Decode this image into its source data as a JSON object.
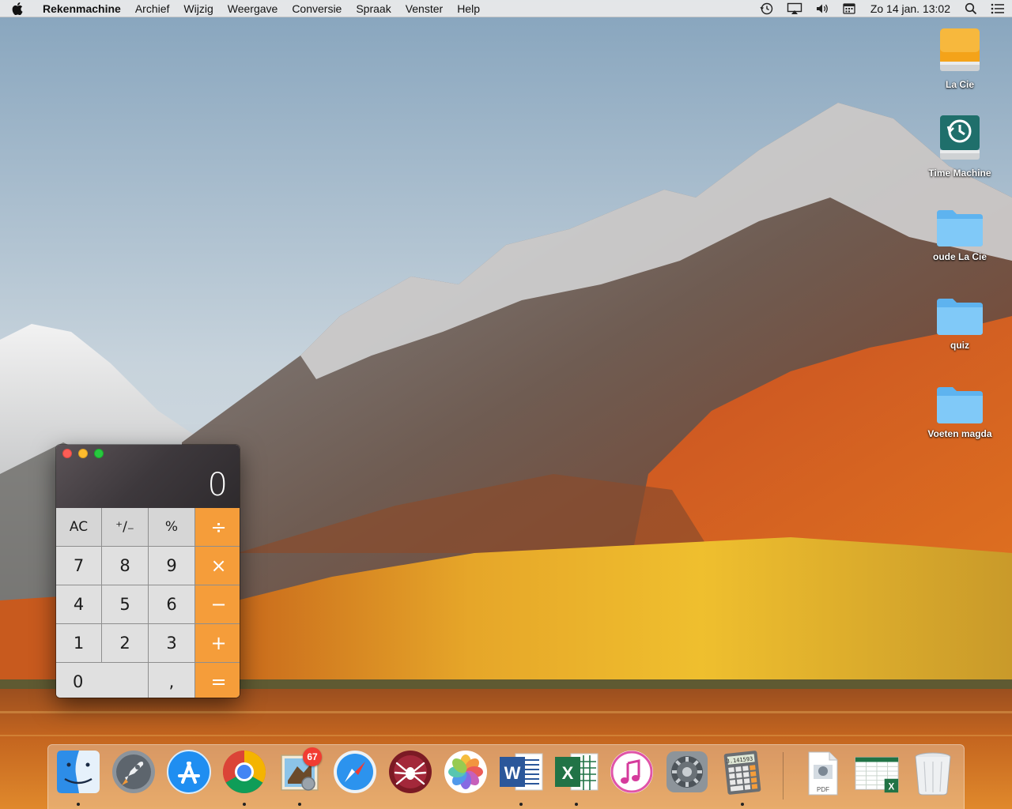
{
  "menubar": {
    "app_name": "Rekenmachine",
    "items": [
      "Archief",
      "Wijzig",
      "Weergave",
      "Conversie",
      "Spraak",
      "Venster",
      "Help"
    ],
    "clock": "Zo 14 jan.  13:02",
    "status_icons": [
      "time-machine-icon",
      "airplay-icon",
      "volume-icon",
      "calendar-icon"
    ]
  },
  "desktop": {
    "icons": [
      {
        "label": "La Cie",
        "icon": "external-drive-icon"
      },
      {
        "label": "Time Machine",
        "icon": "time-machine-drive-icon"
      },
      {
        "label": "oude La Cie",
        "icon": "folder-icon"
      },
      {
        "label": "quiz",
        "icon": "folder-icon"
      },
      {
        "label": "Voeten magda",
        "icon": "folder-icon"
      }
    ]
  },
  "calculator": {
    "display": "0",
    "keys": {
      "ac": "AC",
      "sign": "⁺∕₋",
      "percent": "%",
      "divide": "÷",
      "seven": "7",
      "eight": "8",
      "nine": "9",
      "multiply": "×",
      "four": "4",
      "five": "5",
      "six": "6",
      "minus": "−",
      "one": "1",
      "two": "2",
      "three": "3",
      "plus": "+",
      "zero": "0",
      "decimal": ",",
      "equals": "="
    },
    "colors": {
      "operator": "#f59d3a",
      "digit": "#e0e0e0",
      "function": "#d6d6d6"
    }
  },
  "dock": {
    "items": [
      {
        "icon": "finder-icon",
        "running": true
      },
      {
        "icon": "launchpad-icon",
        "running": false
      },
      {
        "icon": "app-store-icon",
        "running": false
      },
      {
        "icon": "chrome-icon",
        "running": true
      },
      {
        "icon": "mail-icon",
        "running": true,
        "badge": "67"
      },
      {
        "icon": "safari-icon",
        "running": false
      },
      {
        "icon": "spider-app-icon",
        "running": false
      },
      {
        "icon": "photos-icon",
        "running": false
      },
      {
        "icon": "word-icon",
        "running": true
      },
      {
        "icon": "excel-icon",
        "running": true
      },
      {
        "icon": "itunes-icon",
        "running": false
      },
      {
        "icon": "system-preferences-icon",
        "running": false
      },
      {
        "icon": "calculator-icon",
        "running": true
      },
      {
        "icon": "pdf-document-icon",
        "running": false
      },
      {
        "icon": "excel-document-icon",
        "running": false
      },
      {
        "icon": "trash-icon",
        "running": false
      }
    ],
    "calc_icon_text": "3.141593",
    "pdf_label": "PDF"
  }
}
